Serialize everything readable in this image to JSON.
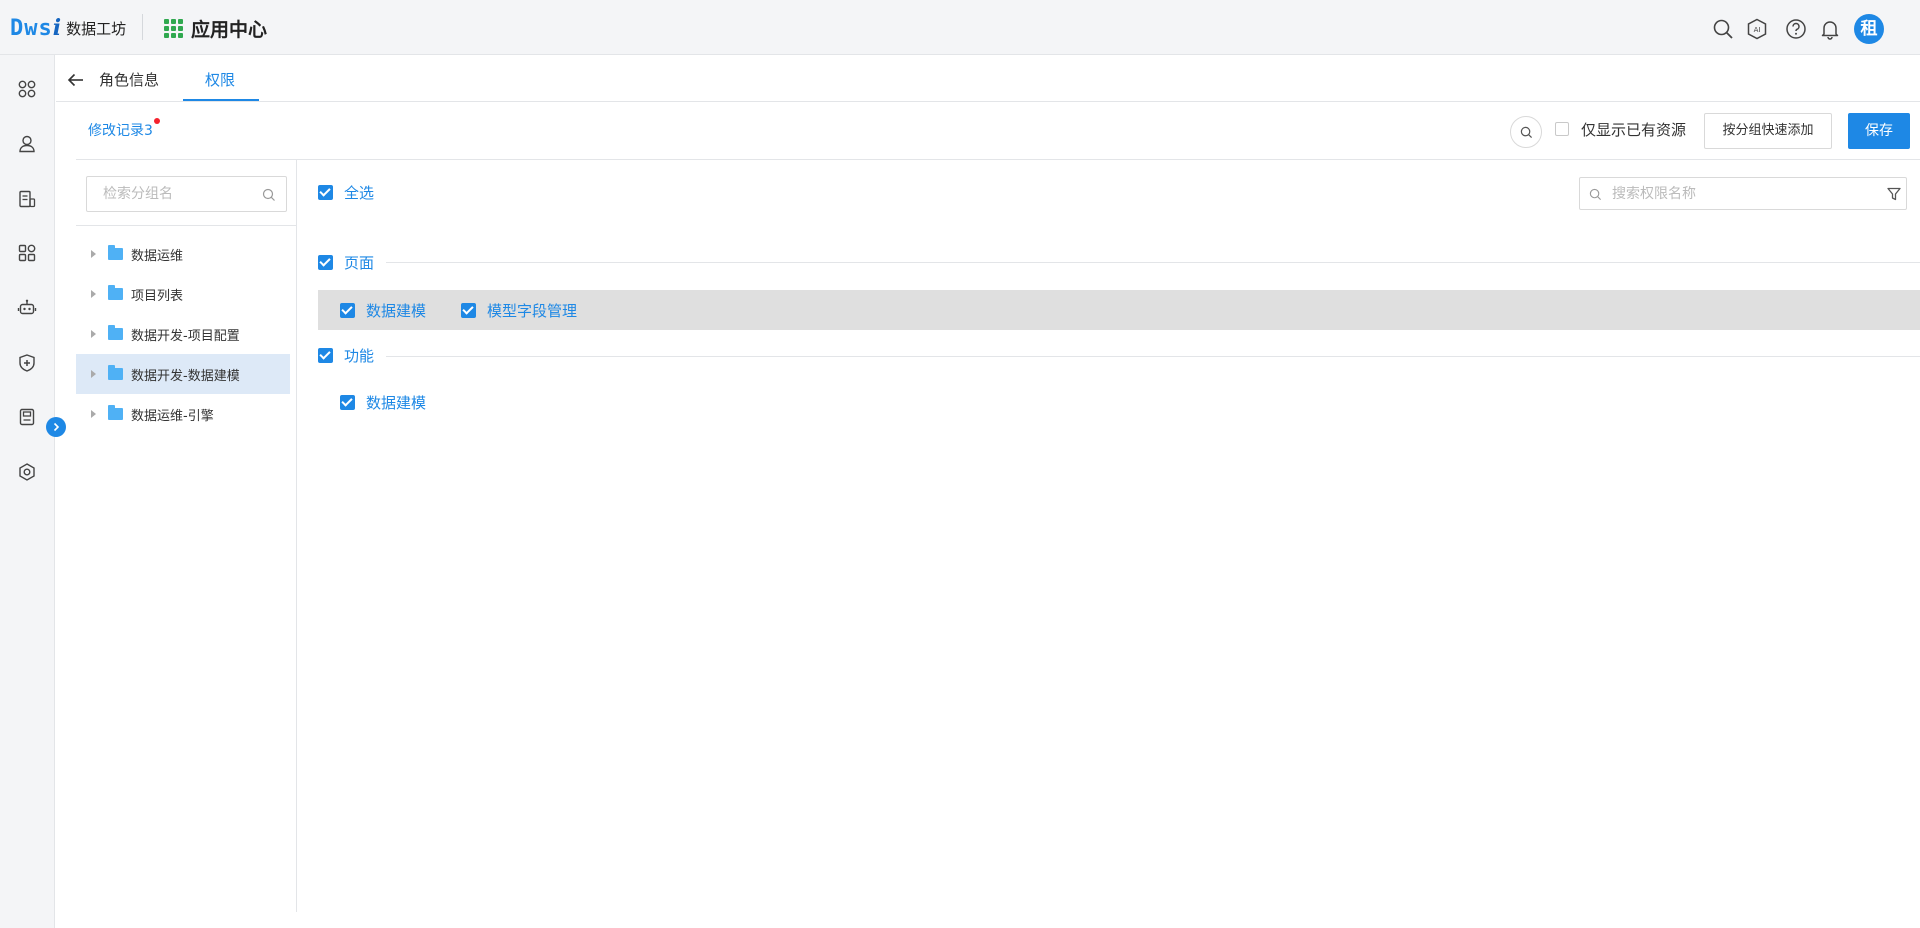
{
  "header": {
    "logo_mark": "Dws",
    "logo_mark_i": "i",
    "logo_text": "数据工坊",
    "app_center": "应用中心",
    "avatar_text": "租",
    "icons": [
      "search-icon",
      "ai-icon",
      "help-icon",
      "bell-icon"
    ]
  },
  "rail": {
    "icons": [
      "apps-icon",
      "user-icon",
      "document-icon",
      "modules-icon",
      "robot-icon",
      "shield-icon",
      "clipboard-icon",
      "settings-icon"
    ],
    "toggle_icon": "chevron-right-icon"
  },
  "tabs": {
    "items": [
      {
        "label": "角色信息",
        "active": false
      },
      {
        "label": "权限",
        "active": true
      }
    ]
  },
  "toolbar": {
    "history_label": "修改记录3",
    "only_existing_label": "仅显示已有资源",
    "quick_add_label": "按分组快速添加",
    "save_label": "保存"
  },
  "tree": {
    "search_placeholder": "检索分组名",
    "items": [
      {
        "label": "数据运维",
        "selected": false
      },
      {
        "label": "项目列表",
        "selected": false
      },
      {
        "label": "数据开发-项目配置",
        "selected": false
      },
      {
        "label": "数据开发-数据建模",
        "selected": true
      },
      {
        "label": "数据运维-引擎",
        "selected": false
      }
    ]
  },
  "permissions": {
    "select_all_label": "全选",
    "search_placeholder": "搜索权限名称",
    "sections": [
      {
        "title": "页面",
        "items": [
          "数据建模",
          "模型字段管理"
        ]
      },
      {
        "title": "功能",
        "items": [
          "数据建模"
        ]
      }
    ]
  },
  "colors": {
    "accent": "#1e88e5",
    "folder": "#4fb1f5",
    "selected_row": "#dde9f7",
    "badge_red": "#f5222d"
  }
}
